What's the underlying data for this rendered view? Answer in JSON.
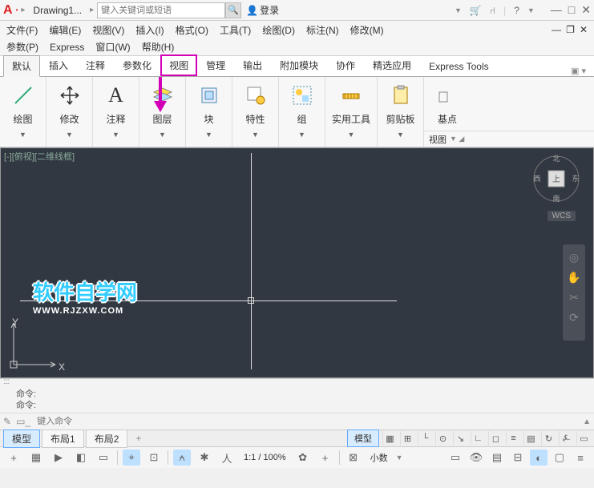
{
  "titlebar": {
    "filename": "Drawing1...",
    "search_placeholder": "键入关键词或短语",
    "login": "登录",
    "arrow1": "▸",
    "arrow2": "▸"
  },
  "menubar": {
    "items": [
      "文件(F)",
      "编辑(E)",
      "视图(V)",
      "插入(I)",
      "格式(O)",
      "工具(T)",
      "绘图(D)",
      "标注(N)",
      "修改(M)"
    ],
    "items2": [
      "参数(P)",
      "Express",
      "窗口(W)",
      "帮助(H)"
    ]
  },
  "tabs": {
    "items": [
      "默认",
      "插入",
      "注释",
      "参数化",
      "视图",
      "管理",
      "输出",
      "附加模块",
      "协作",
      "精选应用",
      "Express Tools"
    ],
    "active": 0,
    "highlight": 4
  },
  "ribbon": {
    "panels": [
      {
        "label": "绘图",
        "icon": "line"
      },
      {
        "label": "修改",
        "icon": "move"
      },
      {
        "label": "注释",
        "icon": "text"
      },
      {
        "label": "图层",
        "icon": "layers"
      },
      {
        "label": "块",
        "icon": "block"
      },
      {
        "label": "特性",
        "icon": "props"
      },
      {
        "label": "组",
        "icon": "group"
      },
      {
        "label": "实用工具",
        "icon": "utils"
      },
      {
        "label": "剪贴板",
        "icon": "clipboard"
      },
      {
        "label": "基点",
        "icon": "base"
      }
    ],
    "viewtab": "视图"
  },
  "canvas": {
    "caption": "[-][俯视][二维线框]",
    "wcs": "WCS",
    "watermark_main": "软件自学网",
    "watermark_sub": "WWW.RJZXW.COM",
    "axis_x": "X",
    "axis_y": "Y"
  },
  "cmdline": {
    "history": [
      "命令:",
      "命令:"
    ],
    "placeholder": "键入命令"
  },
  "bottom_tabs": {
    "items": [
      "模型",
      "布局1",
      "布局2"
    ],
    "active": 0,
    "model_label": "模型"
  },
  "statusbar": {
    "scale": "1:1 / 100%",
    "anno": "小数",
    "person": "人"
  }
}
